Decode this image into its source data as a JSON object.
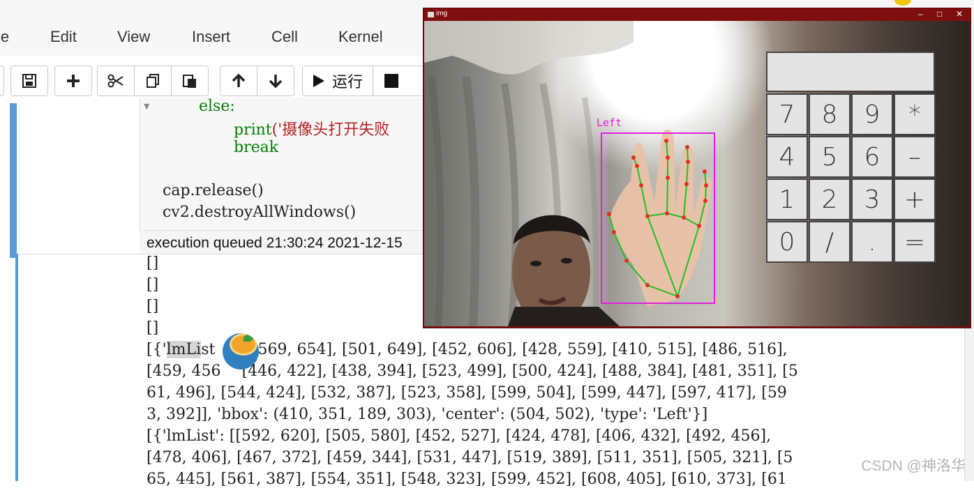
{
  "menu": {
    "items": [
      "le",
      "Edit",
      "View",
      "Insert",
      "Cell",
      "Kernel"
    ]
  },
  "toolbar": {
    "run_label": "运行"
  },
  "code": {
    "line_else": "else:",
    "line_print_fn": "print",
    "line_print_str": "('摄像头打开失败",
    "line_break": "break",
    "line_release": "cap.release()",
    "line_destroy": "cv2.destroyAllWindows()"
  },
  "status": {
    "text": "execution queued 21:30:24 2021-12-15"
  },
  "output": {
    "empty_1": "[]",
    "empty_2": "[]",
    "empty_3": "[]",
    "empty_4": "[]",
    "line_1_pre": "[{'",
    "line_1_hl": "lmLi",
    "line_1_mid": "st",
    "line_1_post": "[[569, 654], [501, 649], [452, 606], [428, 559], [410, 515], [486, 516],",
    "line_2_a": "[459, 456",
    "line_2_b": "[446, 422], [438, 394], [523, 499], [500, 424], [488, 384], [481, 351], [5",
    "line_3": "61, 496], [544, 424], [532, 387], [523, 358], [599, 504], [599, 447], [597, 417], [59",
    "line_4": "3, 392]], 'bbox': (410, 351, 189, 303), 'center': (504, 502), 'type': 'Left'}]",
    "line_5": "[{'lmList': [[592, 620], [505, 580], [452, 527], [424, 478], [406, 432], [492, 456],",
    "line_6": "[478, 406], [467, 372], [459, 344], [531, 447], [519, 389], [511, 351], [505, 321], [5",
    "line_7": "65, 445], [561, 387], [554, 351], [548, 323], [599, 452], [608, 405], [610, 373], [61"
  },
  "img_window": {
    "title": "img",
    "minimize": "–",
    "maximize": "□",
    "close": "✕",
    "hand_label": "Left",
    "calculator_keys": [
      [
        "7",
        "8",
        "9",
        "*"
      ],
      [
        "4",
        "5",
        "6",
        "–"
      ],
      [
        "1",
        "2",
        "3",
        "+"
      ],
      [
        "0",
        "/",
        ".",
        "="
      ]
    ],
    "bbox_color": "#e020e0",
    "landmark_color": "#e03020",
    "connection_color": "#20c020"
  },
  "watermark": "CSDN @神洛华"
}
